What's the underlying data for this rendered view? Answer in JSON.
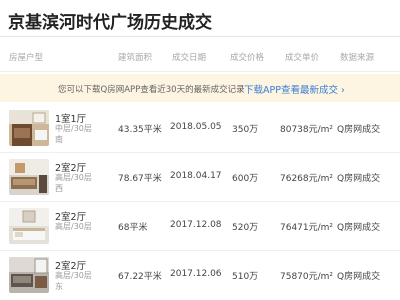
{
  "page_title": "京基滨河时代广场历史成交",
  "table_headers": {
    "layout": "房屋户型",
    "area": "建筑面积",
    "date": "成交日期",
    "price": "成交价格",
    "unit_price": "成交单价",
    "source": "数据来源"
  },
  "banner": {
    "message": "您可以下载Q房网APP查看近30天的最新成交记录",
    "link_label": "下载APP查看最新成交 ›"
  },
  "rows": [
    {
      "layout": "1室1厅",
      "floor_line1": "中层/30层",
      "floor_line2": "南",
      "area": "43.35平米",
      "date": "2018.05.05",
      "price": "350万",
      "unit_price": "80738元/m²",
      "source": "Q房网成交"
    },
    {
      "layout": "2室2厅",
      "floor_line1": "高层/30层",
      "floor_line2": "西",
      "area": "78.67平米",
      "date": "2018.04.17",
      "price": "600万",
      "unit_price": "76268元/m²",
      "source": "Q房网成交"
    },
    {
      "layout": "2室2厅",
      "floor_line1": "高层/30层",
      "floor_line2": "",
      "area": "68平米",
      "date": "2017.12.08",
      "price": "520万",
      "unit_price": "76471元/m²",
      "source": "Q房网成交"
    },
    {
      "layout": "2室2厅",
      "floor_line1": "高层/30层",
      "floor_line2": "东",
      "area": "67.22平米",
      "date": "2017.12.06",
      "price": "510万",
      "unit_price": "75870元/m²",
      "source": "Q房网成交"
    }
  ],
  "colors": {
    "banner_bg": "#fdf4e1",
    "link": "#3a7fd5",
    "header_text": "#a8a8a8"
  }
}
